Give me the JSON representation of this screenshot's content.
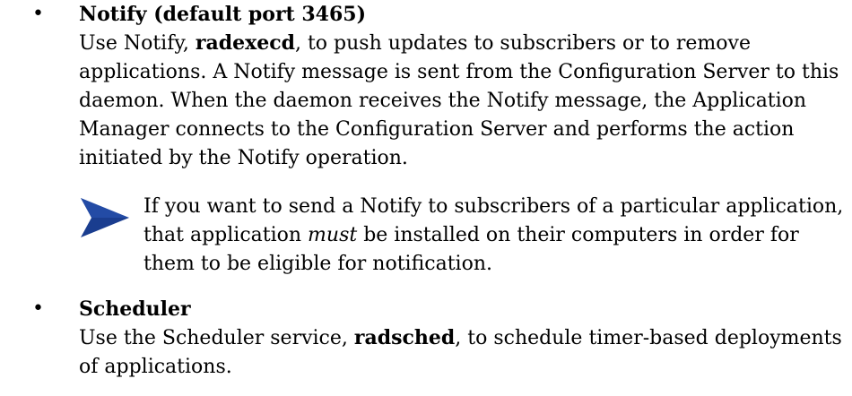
{
  "bullet_char": "•",
  "items": [
    {
      "title": "Notify (default port 3465)",
      "body_before": "Use Notify, ",
      "body_bold": "radexecd",
      "body_after": ", to push updates to subscribers or to remove applications. A Notify message is sent from the Configuration Server to this daemon. When the daemon receives the Notify message, the Application Manager connects to the Configuration Server and performs the action initiated by the Notify operation.",
      "note": {
        "icon": "arrow-right-icon",
        "text_before": "If you want to send a Notify to subscribers of a particular application, that application ",
        "text_italic": "must",
        "text_after": " be installed on their computers in order for them to be eligible for notification."
      }
    },
    {
      "title": "Scheduler",
      "body_before": "Use the Scheduler service, ",
      "body_bold": "radsched",
      "body_after": ", to schedule timer-based deployments of applications."
    }
  ],
  "colors": {
    "note_arrow": "#1a3d8f",
    "text": "#000000"
  }
}
